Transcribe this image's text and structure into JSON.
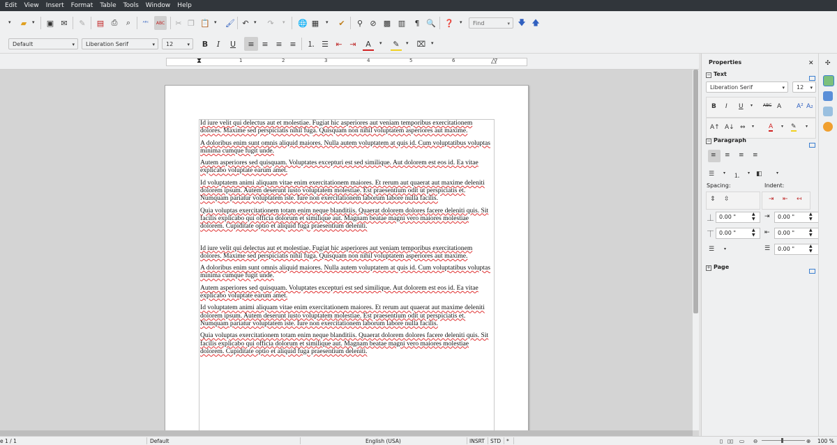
{
  "menu": [
    "Edit",
    "View",
    "Insert",
    "Format",
    "Table",
    "Tools",
    "Window",
    "Help"
  ],
  "toolbar": {
    "find_placeholder": "Find",
    "style_value": "Default",
    "font_value": "Liberation Serif",
    "size_value": "12",
    "bold": "B",
    "italic": "I",
    "underline": "U"
  },
  "ruler": {
    "numbers": [
      "1",
      "2",
      "3",
      "4",
      "5",
      "6",
      "7"
    ]
  },
  "document": {
    "paragraphs": [
      "Id iure velit qui delectus aut et molestiae. Fugiat hic asperiores aut veniam temporibus exercitationem dolores. Maxime sed perspiciatis nihil fuga. Quisquam non nihil voluptatem asperiores aut maxime.",
      "A doloribus enim sunt omnis aliquid maiores. Nulla autem voluptatem at quis id. Cum voluptatibus voluptas minima cumque fugit unde.",
      "Autem asperiores sed quisquam. Voluptates excepturi est sed similique. Aut dolorem est eos id. Ea vitae explicabo voluptate earum amet.",
      "Id voluptatem animi aliquam vitae enim exercitationem maiores. Et rerum aut quaerat aut maxime deleniti dolorem ipsum. Autem deserunt iusto voluptatem molestiae. Est praesentium odit ut perspiciatis et. Numquam pariatur voluptatem iste. Iure non exercitationem laborum labore nulla facilis.",
      "Quia voluptas exercitationem totam enim neque blanditiis. Quaerat dolorem dolores facere deleniti quis. Sit facilis explicabo qui officia dolorum et similique aut. Magnam beatae magni vero maiores molestiae dolorem. Cupiditate optio et aliquid fuga praesentium deleniti.",
      "Id iure velit qui delectus aut et molestiae. Fugiat hic asperiores aut veniam temporibus exercitationem dolores. Maxime sed perspiciatis nihil fuga. Quisquam non nihil voluptatem asperiores aut maxime.",
      "A doloribus enim sunt omnis aliquid maiores. Nulla autem voluptatem at quis id. Cum voluptatibus voluptas minima cumque fugit unde.",
      "Autem asperiores sed quisquam. Voluptates excepturi est sed similique. Aut dolorem est eos id. Ea vitae explicabo voluptate earum amet.",
      "Id voluptatem animi aliquam vitae enim exercitationem maiores. Et rerum aut quaerat aut maxime deleniti dolorem ipsum. Autem deserunt iusto voluptatem molestiae. Est praesentium odit ut perspiciatis et. Numquam pariatur voluptatem iste. Iure non exercitationem laborum labore nulla facilis.",
      "Quia voluptas exercitationem totam enim neque blanditiis. Quaerat dolorem dolores facere deleniti quis. Sit facilis explicabo qui officia dolorum et similique aut. Magnam beatae magni vero maiores molestiae dolorem. Cupiditate optio et aliquid fuga praesentium deleniti."
    ]
  },
  "sidebar": {
    "title": "Properties",
    "text_header": "Text",
    "font_value": "Liberation Serif",
    "size_value": "12",
    "paragraph_header": "Paragraph",
    "spacing_label": "Spacing:",
    "indent_label": "Indent:",
    "above_spacing": "0.00 \"",
    "below_spacing": "0.00 \"",
    "before_indent": "0.00 \"",
    "after_indent": "0.00 \"",
    "first_line_indent": "0.00 \"",
    "page_header": "Page"
  },
  "status": {
    "page": "e 1 / 1",
    "style": "Default",
    "language": "English (USA)",
    "insert_mode": "INSRT",
    "selection_mode": "STD",
    "modified": "*",
    "zoom": "100 %"
  },
  "colors": {
    "menubar": "#31363b",
    "toolbar": "#eff0f1",
    "spellcheck": "#e03030",
    "accent": "#3b7fd0"
  }
}
